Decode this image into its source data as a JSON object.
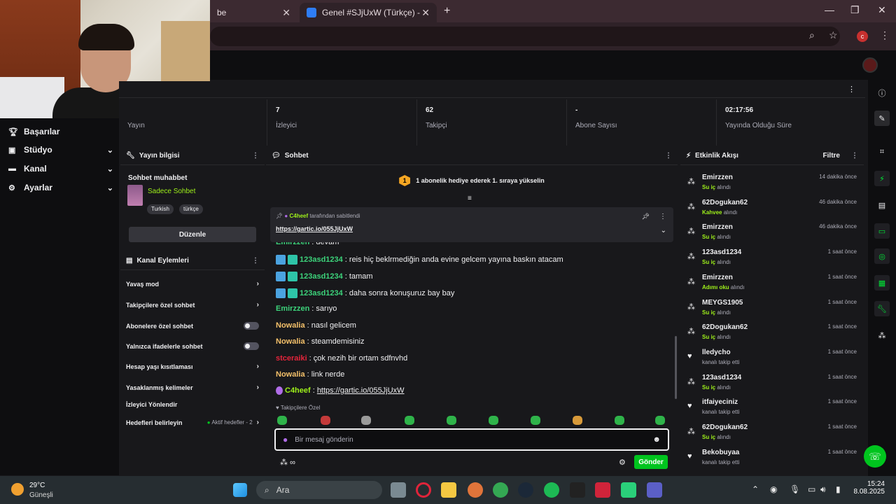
{
  "browser": {
    "tabs": [
      {
        "label": "be",
        "close": "✕"
      },
      {
        "label": "Genel #SJjUxW (Türkçe) - Gartic",
        "close": "✕"
      }
    ],
    "new_tab": "+",
    "window_controls": {
      "minimize": "—",
      "maximize": "❐",
      "close": "✕"
    },
    "profile_initial": "c"
  },
  "sidebar": {
    "items": [
      {
        "label": "Başarılar",
        "icon": "trophy-icon"
      },
      {
        "label": "Stüdyo",
        "icon": "studio-icon",
        "chevron": "⌄"
      },
      {
        "label": "Kanal",
        "icon": "channel-icon",
        "chevron": "⌄"
      },
      {
        "label": "Ayarlar",
        "icon": "gear-icon",
        "chevron": "⌄"
      }
    ]
  },
  "stats": {
    "items": [
      {
        "value": "",
        "label": "Yayın"
      },
      {
        "value": "7",
        "label": "İzleyici"
      },
      {
        "value": "62",
        "label": "Takipçi"
      },
      {
        "value": "-",
        "label": "Abone Sayısı"
      },
      {
        "value": "02:17:56",
        "label": "Yayında Olduğu Süre"
      }
    ]
  },
  "stream_info": {
    "title": "Yayın bilgisi",
    "stream_title": "Sohbet muhabbet",
    "category": "Sadece Sohbet",
    "tags": [
      "Turkish",
      "türkçe"
    ],
    "edit_label": "Düzenle"
  },
  "channel_actions": {
    "title": "Kanal Eylemleri",
    "rows": [
      {
        "label": "Yavaş mod",
        "type": "chevron"
      },
      {
        "label": "Takipçilere özel sohbet",
        "type": "chevron"
      },
      {
        "label": "Abonelere özel sohbet",
        "type": "toggle"
      },
      {
        "label": "Yalnızca ifadelerle sohbet",
        "type": "toggle"
      },
      {
        "label": "Hesap yaşı kısıtlaması",
        "type": "chevron"
      },
      {
        "label": "Yasaklanmış kelimeler",
        "type": "chevron"
      },
      {
        "label": "İzleyici Yönlendir",
        "type": "none"
      },
      {
        "label": "Hedefleri belirleyin",
        "type": "chevron",
        "extra": "Aktif hedefler - 2"
      }
    ]
  },
  "chat": {
    "title": "Sohbet",
    "banner": "1 abonelik hediye ederek 1. sıraya yükselin",
    "banner_rank": "1",
    "pinned": {
      "user": "C4heef",
      "suffix": "tarafından sabitlendi",
      "link": "https://gartic.io/055JjUxW"
    },
    "messages": [
      {
        "user": "Emirzzen",
        "color": "#3cd27a",
        "text": "devam",
        "badges": 0
      },
      {
        "user": "123asd1234",
        "color": "#3cd27a",
        "text": "reis hiç beklrmediğin anda evine gelcem yayına baskın atacam",
        "badges": 2
      },
      {
        "user": "123asd1234",
        "color": "#3cd27a",
        "text": "tamam",
        "badges": 2
      },
      {
        "user": "123asd1234",
        "color": "#3cd27a",
        "text": "daha sonra konuşuruz bay bay",
        "badges": 2
      },
      {
        "user": "Emirzzen",
        "color": "#3cd27a",
        "text": "sarıyo",
        "badges": 0
      },
      {
        "user": "Nowalia",
        "color": "#f4c06a",
        "text": "nasıl gelicem",
        "badges": 0
      },
      {
        "user": "Nowalia",
        "color": "#f4c06a",
        "text": "steamdemisiniz",
        "badges": 0
      },
      {
        "user": "stceraiki",
        "color": "#e5243b",
        "text": "çok nezih bir ortam sdfnvhd",
        "badges": 0
      },
      {
        "user": "Nowalia",
        "color": "#f4c06a",
        "text": "link nerde",
        "badges": 0
      },
      {
        "user": "C4heef",
        "color": "#9ef01a",
        "text": "https://gartic.io/055JjUxW",
        "badges": 1,
        "link": true
      }
    ],
    "followers_only_label": "Takipçilere Özel",
    "input_placeholder": "Bir mesaj gönderin",
    "points": "∞",
    "send_label": "Gönder"
  },
  "activity": {
    "title": "Etkinlik Akışı",
    "filter_label": "Filtre",
    "items": [
      {
        "user": "Emirzzen",
        "reward": "Su iç",
        "action": "alındı",
        "time": "14 dakika önce",
        "kind": "reward"
      },
      {
        "user": "62Dogukan62",
        "reward": "Kahvee",
        "action": "alındı",
        "time": "46 dakika önce",
        "kind": "reward"
      },
      {
        "user": "Emirzzen",
        "reward": "Su iç",
        "action": "alındı",
        "time": "46 dakika önce",
        "kind": "reward"
      },
      {
        "user": "123asd1234",
        "reward": "Su iç",
        "action": "alındı",
        "time": "1 saat önce",
        "kind": "reward"
      },
      {
        "user": "Emirzzen",
        "reward": "Adımı oku",
        "action": "alındı",
        "time": "1 saat önce",
        "kind": "reward"
      },
      {
        "user": "MEYGS1905",
        "reward": "Su iç",
        "action": "alındı",
        "time": "1 saat önce",
        "kind": "reward"
      },
      {
        "user": "62Dogukan62",
        "reward": "Su iç",
        "action": "alındı",
        "time": "1 saat önce",
        "kind": "reward"
      },
      {
        "user": "lledycho",
        "reward": "",
        "action": "kanalı takip etti",
        "time": "1 saat önce",
        "kind": "follow"
      },
      {
        "user": "123asd1234",
        "reward": "Su iç",
        "action": "alındı",
        "time": "1 saat önce",
        "kind": "reward"
      },
      {
        "user": "itfaiyeciniz",
        "reward": "",
        "action": "kanalı takip etti",
        "time": "1 saat önce",
        "kind": "follow"
      },
      {
        "user": "62Dogukan62",
        "reward": "Su iç",
        "action": "alındı",
        "time": "1 saat önce",
        "kind": "reward"
      },
      {
        "user": "Bekobuyaa",
        "reward": "",
        "action": "kanalı takip etti",
        "time": "1 saat önce",
        "kind": "follow"
      }
    ]
  },
  "taskbar": {
    "weather_temp": "29°C",
    "weather_desc": "Güneşli",
    "search_label": "Ara",
    "time": "15:24",
    "date": "8.08.2025"
  },
  "colors": {
    "accent": "#00c41e",
    "reward_text": "#9ef01a",
    "background": "#18181b"
  }
}
